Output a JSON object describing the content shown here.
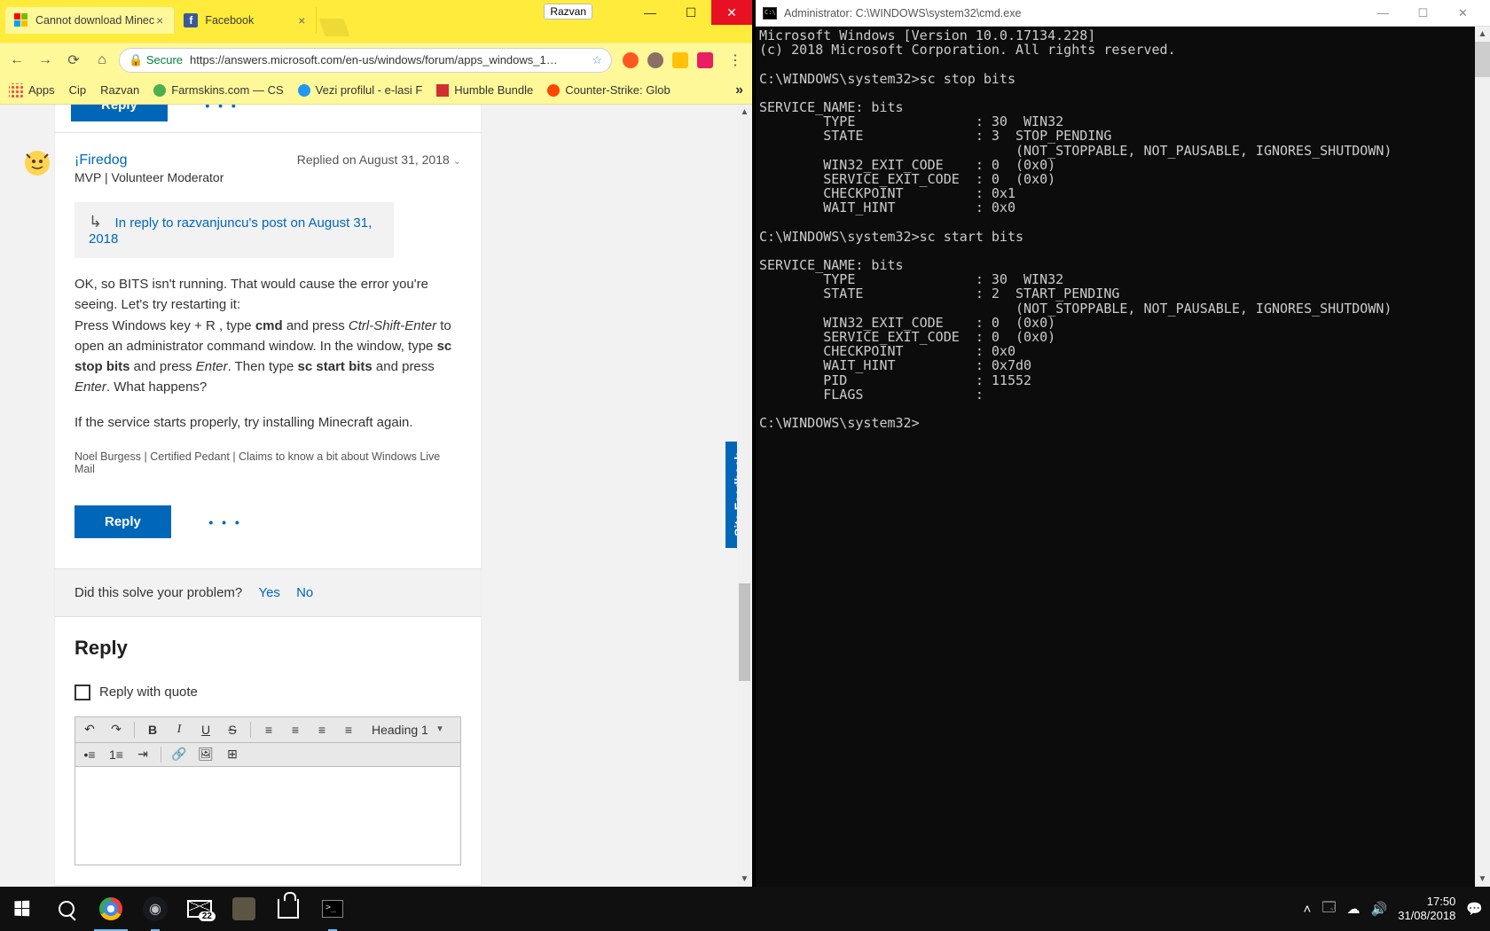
{
  "chrome": {
    "user": "Razvan",
    "tabs": [
      {
        "title": "Cannot download Minec",
        "active": true
      },
      {
        "title": "Facebook",
        "active": false
      }
    ],
    "secure_label": "Secure",
    "url": "https://answers.microsoft.com/en-us/windows/forum/apps_windows_1…",
    "bookmarks_bar": {
      "apps": "Apps",
      "items": [
        "Cip",
        "Razvan",
        "Farmskins.com — CS",
        "Vezi profilul - e-lasi F",
        "Humble Bundle",
        "Counter-Strike: Glob"
      ]
    }
  },
  "forum": {
    "reply_label": "Reply",
    "username": "¡Firedog",
    "role": "MVP | Volunteer Moderator",
    "replied_on": "Replied on August 31, 2018",
    "in_reply_to": "In reply to razvanjuncu's post on August 31, 2018",
    "body_p1_a": "OK, so BITS isn't running. That would cause the error you're seeing. Let's try restarting it:",
    "body_p2_a": "Press Windows key + R , type ",
    "body_p2_cmd": "cmd",
    "body_p2_b": " and press ",
    "body_p2_cse": "Ctrl-Shift-Enter",
    "body_p2_c": " to open an administrator command window. In the window, type ",
    "body_p2_sc1": "sc stop bits",
    "body_p2_d": " and press ",
    "body_p2_enter1": "Enter",
    "body_p2_e": ". Then type ",
    "body_p2_sc2": "sc start bits",
    "body_p2_f": " and press ",
    "body_p2_enter2": "Enter",
    "body_p2_g": ". What happens?",
    "body_p3": "If the service starts properly, try installing Minecraft again.",
    "signature": "Noel Burgess | Certified Pedant | Claims to know a bit about Windows Live Mail",
    "solve_q": "Did this solve your problem?",
    "yes": "Yes",
    "no": "No",
    "reply_heading": "Reply",
    "reply_quote": "Reply with quote",
    "heading_select": "Heading 1",
    "feedback": "Site Feedback"
  },
  "cmd": {
    "title": "Administrator: C:\\WINDOWS\\system32\\cmd.exe",
    "output": "Microsoft Windows [Version 10.0.17134.228]\n(c) 2018 Microsoft Corporation. All rights reserved.\n\nC:\\WINDOWS\\system32>sc stop bits\n\nSERVICE_NAME: bits\n        TYPE               : 30  WIN32\n        STATE              : 3  STOP_PENDING\n                                (NOT_STOPPABLE, NOT_PAUSABLE, IGNORES_SHUTDOWN)\n        WIN32_EXIT_CODE    : 0  (0x0)\n        SERVICE_EXIT_CODE  : 0  (0x0)\n        CHECKPOINT         : 0x1\n        WAIT_HINT          : 0x0\n\nC:\\WINDOWS\\system32>sc start bits\n\nSERVICE_NAME: bits\n        TYPE               : 30  WIN32\n        STATE              : 2  START_PENDING\n                                (NOT_STOPPABLE, NOT_PAUSABLE, IGNORES_SHUTDOWN)\n        WIN32_EXIT_CODE    : 0  (0x0)\n        SERVICE_EXIT_CODE  : 0  (0x0)\n        CHECKPOINT         : 0x0\n        WAIT_HINT          : 0x7d0\n        PID                : 11552\n        FLAGS              :\n\nC:\\WINDOWS\\system32>"
  },
  "taskbar": {
    "mail_badge": "22",
    "time": "17:50",
    "date": "31/08/2018"
  }
}
